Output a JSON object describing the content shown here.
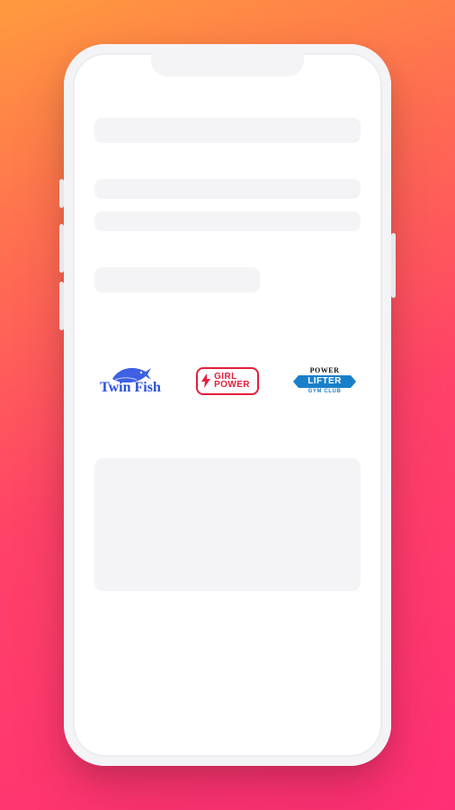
{
  "brands": {
    "twinfish": {
      "label": "Twin Fish"
    },
    "girlpower": {
      "line1": "GIRL",
      "line2": "POWER"
    },
    "powerlifter": {
      "top": "POWER",
      "main": "LIFTER",
      "sub": "GYM CLUB"
    }
  }
}
